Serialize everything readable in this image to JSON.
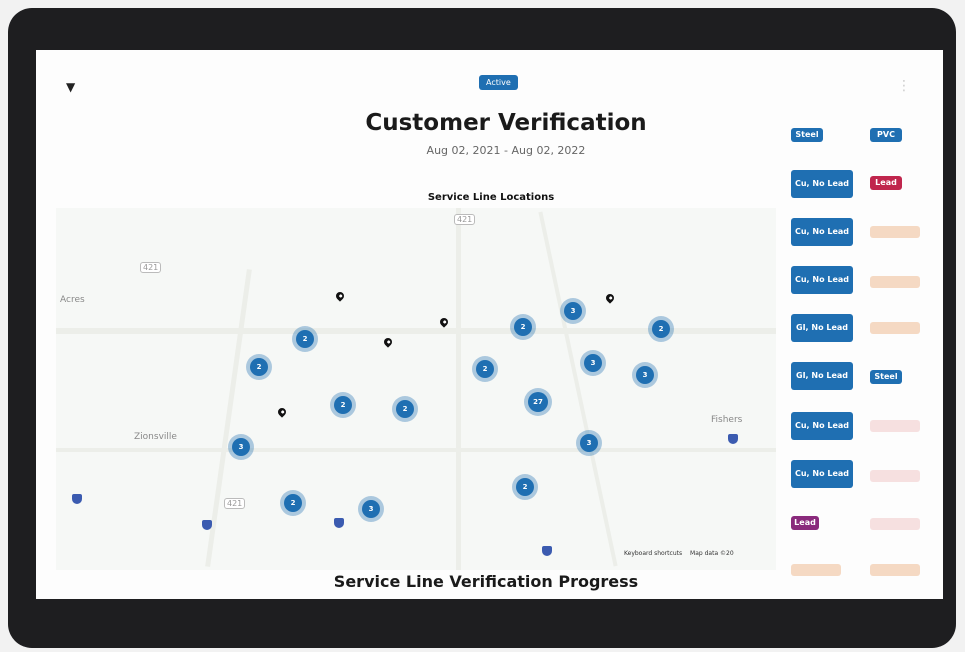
{
  "header": {
    "status_pill": "Active",
    "title": "Customer Verification",
    "date_range": "Aug 02, 2021 - Aug 02, 2022"
  },
  "map": {
    "title": "Service Line Locations",
    "place_labels": [
      "Acres",
      "Zionsville",
      "Fishers"
    ],
    "route_labels": [
      "421",
      "421",
      "421"
    ],
    "clusters": [
      {
        "count": "2"
      },
      {
        "count": "2"
      },
      {
        "count": "3"
      },
      {
        "count": "2"
      },
      {
        "count": "2"
      },
      {
        "count": "2"
      },
      {
        "count": "2"
      },
      {
        "count": "27"
      },
      {
        "count": "3"
      },
      {
        "count": "3"
      },
      {
        "count": "2"
      },
      {
        "count": "2"
      },
      {
        "count": "3"
      },
      {
        "count": "2"
      },
      {
        "count": "3"
      },
      {
        "count": "3"
      }
    ],
    "attribution": {
      "shortcuts": "Keyboard shortcuts",
      "map_data": "Map data ©20"
    }
  },
  "section": {
    "progress_title": "Service Line Verification Progress"
  },
  "material_badges": {
    "left": [
      "Steel",
      "Cu, No Lead",
      "Cu, No Lead",
      "Cu, No Lead",
      "GI, No Lead",
      "GI, No Lead",
      "Cu, No Lead",
      "Cu, No Lead",
      "Lead"
    ],
    "right": [
      "PVC",
      "Lead",
      "Steel"
    ]
  },
  "colors": {
    "accent": "#1f6fb2",
    "lead": "#c0264d",
    "lead_purple": "#8a2a7c",
    "bezel": "#1e1e20"
  }
}
